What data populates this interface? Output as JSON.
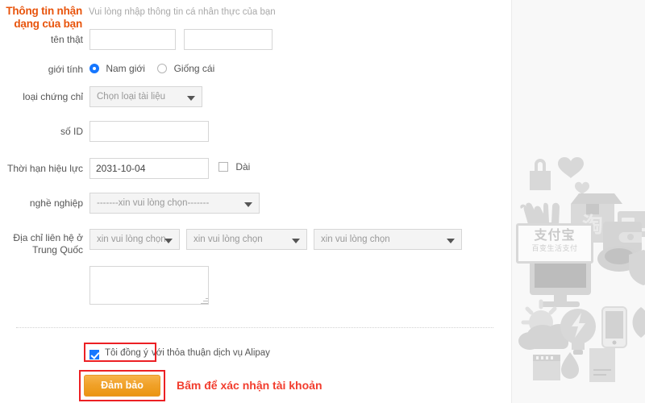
{
  "page": {
    "section_title": "Thông tin nhận dạng của bạn",
    "hint": "Vui lòng nhập thông tin cá nhân thực của bạn"
  },
  "form": {
    "real_name": {
      "label": "tên thật",
      "first_value": "",
      "first_placeholder": "",
      "last_value": "",
      "last_placeholder": ""
    },
    "gender": {
      "label": "giới tính",
      "options": [
        "Nam giới",
        "Giống cái"
      ],
      "selected": "Nam giới"
    },
    "doc_type": {
      "label": "loại chứng chỉ",
      "value": "Chọn loại tài liệu"
    },
    "id_number": {
      "label": "số ID",
      "value": "",
      "placeholder": ""
    },
    "validity": {
      "label": "Thời hạn hiệu lực",
      "value": "2031-10-04",
      "long_term_label": "Dài",
      "long_term_checked": false
    },
    "occupation": {
      "label": "nghề nghiệp",
      "value": "-------xin vui lòng chọn-------"
    },
    "address": {
      "label": "Địa chỉ liên hệ ở Trung Quốc",
      "label_line1": "Địa chỉ liên hệ ở",
      "label_line2": "Trung Quốc",
      "province": "xin vui lòng chọn",
      "city": "xin vui lòng chọn",
      "district": "xin vui lòng chọn",
      "detail_value": "",
      "detail_placeholder": ""
    },
    "agreement": {
      "checked": true,
      "checked_label": "Tôi đồng ý",
      "rest_label": "với thỏa thuận dịch vụ Alipay"
    },
    "submit_label": "Đảm bảo"
  },
  "annotations": {
    "callout_text": "Bấm để xác nhận tài khoản",
    "highlight_color": "#ec2024",
    "callout_color": "#f23d2e"
  },
  "art": {
    "brand_logo": "支付宝",
    "brand_tagline": "百变生活支付",
    "box_glyph": "淘",
    "icons": [
      "lock-icon",
      "heart-icon",
      "small-heart-icon",
      "hands-icon",
      "package-box-icon",
      "credit-card-icon",
      "laptop-icon",
      "wallet-icon",
      "coffee-cup-icon",
      "shield-icon",
      "monitor-icon",
      "sun-icon",
      "cloud-icon",
      "lightbulb-icon",
      "smartphone-icon",
      "leaf-icon",
      "calendar-icon",
      "water-drop-icon",
      "document-icon"
    ]
  },
  "colors": {
    "title": "#e8540c",
    "accent_button": "#f0a128",
    "checkbox_blue": "#1677ff",
    "panel_bg": "#f8f8f8"
  }
}
